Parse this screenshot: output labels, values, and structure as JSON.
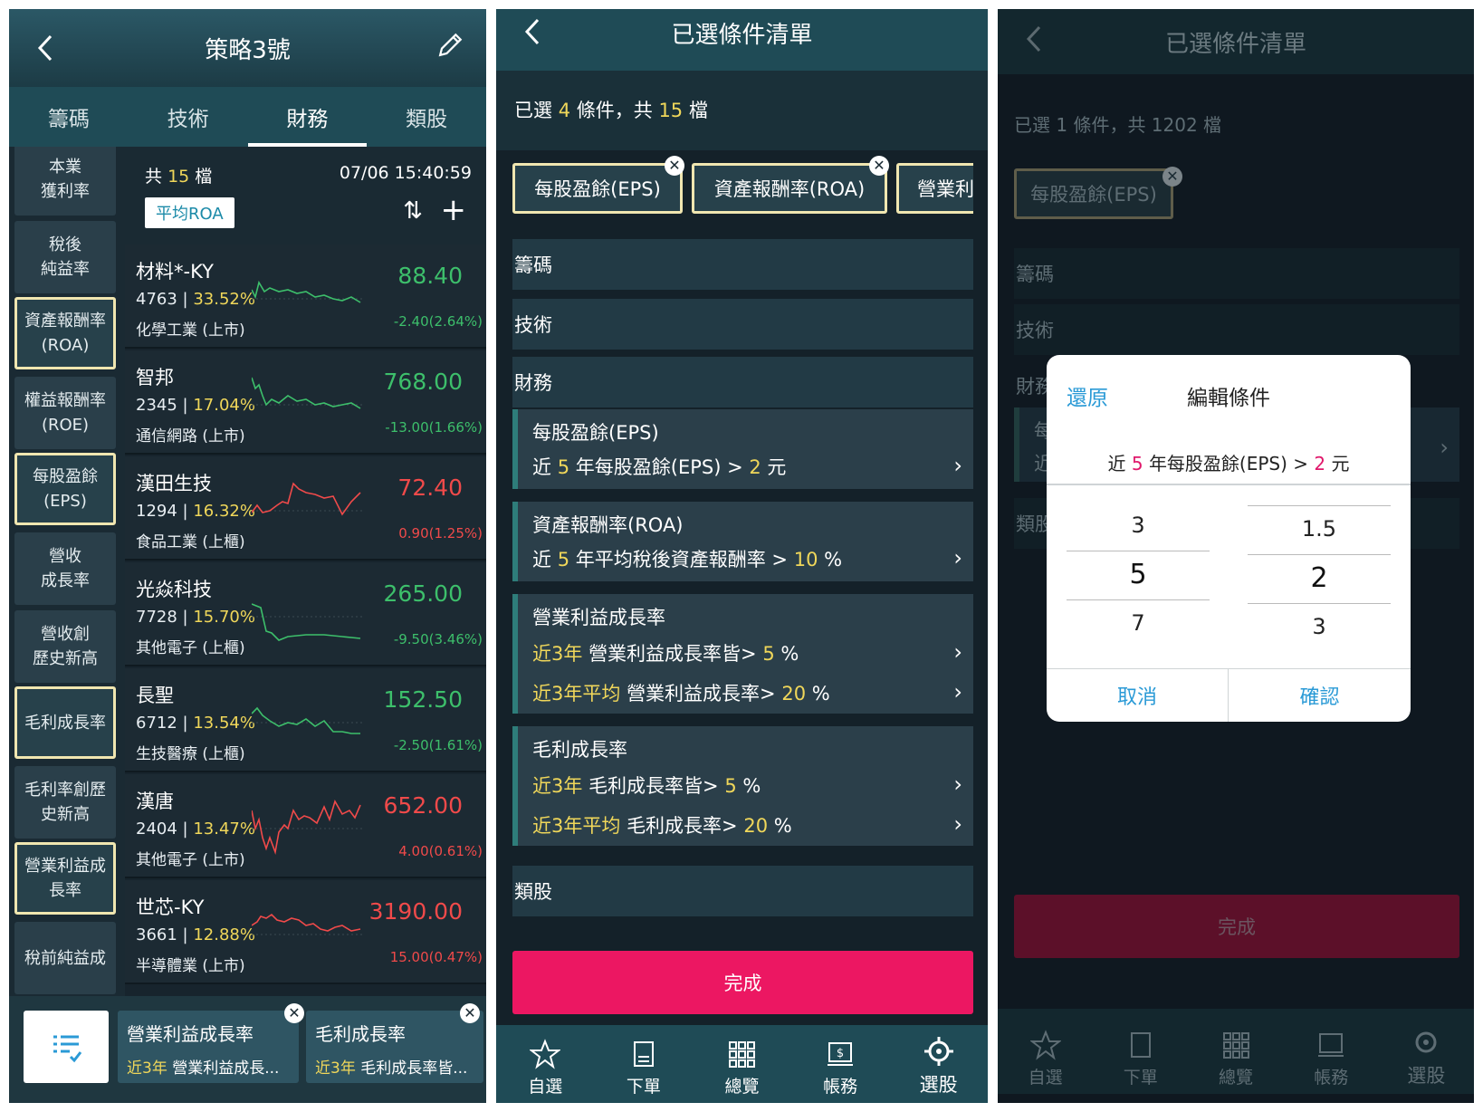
{
  "panel1": {
    "title": "策略3號",
    "tabs": [
      "籌碼",
      "技術",
      "財務",
      "類股"
    ],
    "active_tab": "財務",
    "sidebar": [
      {
        "label": "本業\n獲利率",
        "selected": false
      },
      {
        "label": "稅後\n純益率",
        "selected": false
      },
      {
        "label": "資產報酬率\n(ROA)",
        "selected": true
      },
      {
        "label": "權益報酬率\n(ROE)",
        "selected": false
      },
      {
        "label": "每股盈餘\n(EPS)",
        "selected": true
      },
      {
        "label": "營收\n成長率",
        "selected": false
      },
      {
        "label": "營收創\n歷史新高",
        "selected": false
      },
      {
        "label": "毛利成長率",
        "selected": true
      },
      {
        "label": "毛利率創歷\n史新高",
        "selected": false
      },
      {
        "label": "營業利益成\n長率",
        "selected": true
      },
      {
        "label": "稅前純益成",
        "selected": false
      }
    ],
    "count_prefix": "共",
    "count": "15",
    "count_suffix": "檔",
    "datetime": "07/06 15:40:59",
    "sort_label": "平均ROA",
    "stocks": [
      {
        "name": "材料*-KY",
        "code": "4763",
        "pct": "33.52%",
        "industry": "化學工業 (上市)",
        "price": "88.40",
        "change": "-2.40(2.64%)",
        "dir": "dn"
      },
      {
        "name": "智邦",
        "code": "2345",
        "pct": "17.04%",
        "industry": "通信網路 (上市)",
        "price": "768.00",
        "change": "-13.00(1.66%)",
        "dir": "dn"
      },
      {
        "name": "漢田生技",
        "code": "1294",
        "pct": "16.32%",
        "industry": "食品工業 (上櫃)",
        "price": "72.40",
        "change": "0.90(1.25%)",
        "dir": "up"
      },
      {
        "name": "光焱科技",
        "code": "7728",
        "pct": "15.70%",
        "industry": "其他電子 (上櫃)",
        "price": "265.00",
        "change": "-9.50(3.46%)",
        "dir": "dn"
      },
      {
        "name": "長聖",
        "code": "6712",
        "pct": "13.54%",
        "industry": "生技醫療 (上櫃)",
        "price": "152.50",
        "change": "-2.50(1.61%)",
        "dir": "dn"
      },
      {
        "name": "漢唐",
        "code": "2404",
        "pct": "13.47%",
        "industry": "其他電子 (上市)",
        "price": "652.00",
        "change": "4.00(0.61%)",
        "dir": "up"
      },
      {
        "name": "世芯-KY",
        "code": "3661",
        "pct": "12.88%",
        "industry": "半導體業 (上市)",
        "price": "3190.00",
        "change": "15.00(0.47%)",
        "dir": "up"
      }
    ],
    "bottom_chips": [
      {
        "title": "營業利益成長率",
        "prefix": "近3年",
        "desc": "營業利益成長..."
      },
      {
        "title": "毛利成長率",
        "prefix": "近3年",
        "desc": "毛利成長率皆..."
      }
    ]
  },
  "panel2": {
    "title": "已選條件清單",
    "summary": {
      "a": "已選",
      "n1": "4",
      "b": "條件，共",
      "n2": "15",
      "c": "檔"
    },
    "chips": [
      "每股盈餘(EPS)",
      "資產報酬率(ROA)",
      "營業利"
    ],
    "sections": [
      "籌碼",
      "技術",
      "財務",
      "類股"
    ],
    "cards": [
      {
        "title": "每股盈餘(EPS)",
        "lines": [
          {
            "pre": "近",
            "y1": "5",
            "mid": "年每股盈餘(EPS) >",
            "y2": "2",
            "post": "元"
          }
        ]
      },
      {
        "title": "資產報酬率(ROA)",
        "lines": [
          {
            "pre": "近",
            "y1": "5",
            "mid": "年平均稅後資產報酬率 >",
            "y2": "10",
            "post": "%"
          }
        ]
      },
      {
        "title": "營業利益成長率",
        "lines": [
          {
            "y0": "近3年",
            "mid": "營業利益成長率皆>",
            "y2": "5",
            "post": "%"
          },
          {
            "y0": "近3年平均",
            "mid": "營業利益成長率>",
            "y2": "20",
            "post": "%"
          }
        ]
      },
      {
        "title": "毛利成長率",
        "lines": [
          {
            "y0": "近3年",
            "mid": "毛利成長率皆>",
            "y2": "5",
            "post": "%"
          },
          {
            "y0": "近3年平均",
            "mid": "毛利成長率>",
            "y2": "20",
            "post": "%"
          }
        ]
      }
    ],
    "done": "完成",
    "nav": [
      "自選",
      "下單",
      "總覽",
      "帳務",
      "選股"
    ]
  },
  "panel3": {
    "title": "已選條件清單",
    "summary": "已選 1 條件，共 1202 檔",
    "chip": "每股盈餘(EPS)",
    "sections": [
      "籌碼",
      "技術",
      "財務",
      "類股"
    ],
    "card_partial": [
      "每",
      "近"
    ],
    "done": "完成",
    "nav": [
      "自選",
      "下單",
      "總覽",
      "帳務",
      "選股"
    ],
    "modal": {
      "reset": "還原",
      "title": "編輯條件",
      "expr_pre": "近",
      "expr_y": "5",
      "expr_mid": "年每股盈餘(EPS) >",
      "expr_v": "2",
      "expr_post": "元",
      "col1": [
        "3",
        "5",
        "7"
      ],
      "col2": [
        "1.5",
        "2",
        "3"
      ],
      "cancel": "取消",
      "confirm": "確認"
    }
  },
  "colors": {
    "accent_pink": "#ec1762",
    "up": "#f04a4a",
    "down": "#3dbf6b",
    "highlight": "#f0d75a",
    "teal": "#1f4b56",
    "modal_blue": "#2a9ad6"
  }
}
